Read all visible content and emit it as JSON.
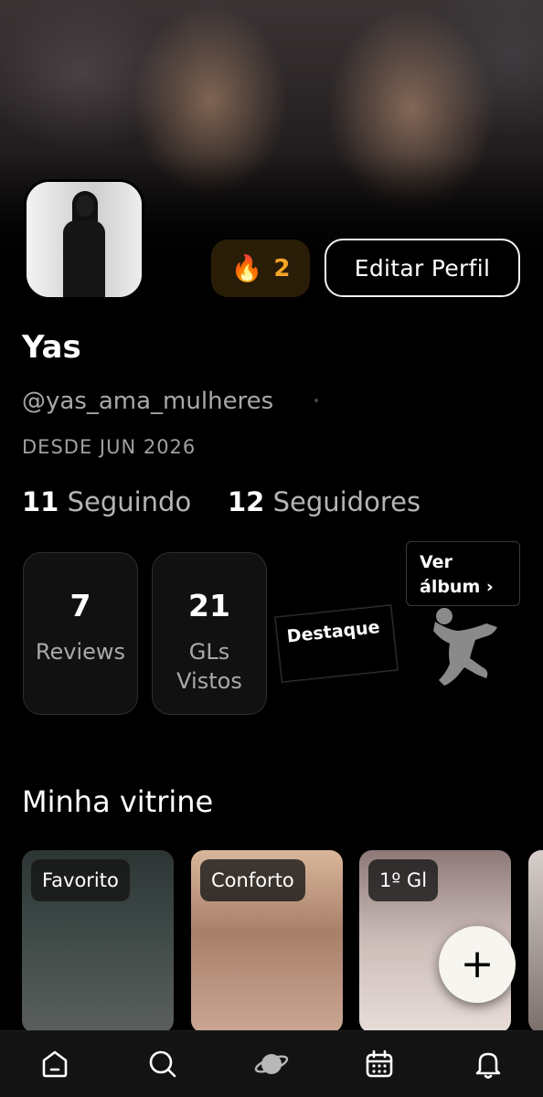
{
  "header": {
    "streak": {
      "icon": "fire-icon",
      "emoji": "🔥",
      "count": "2"
    },
    "edit_button_label": "Editar Perfil"
  },
  "profile": {
    "name": "Yas",
    "handle": "@yas_ama_mulheres",
    "since": "DESDE JUN 2026",
    "following_count": "11",
    "following_label": "Seguindo",
    "followers_count": "12",
    "followers_label": "Seguidores"
  },
  "stats": [
    {
      "value": "7",
      "label": "Reviews"
    },
    {
      "value": "21",
      "label": "GLs Vistos"
    }
  ],
  "badges": {
    "destaque_label": "Destaque",
    "album_label": "Ver álbum ›"
  },
  "showcase": {
    "title": "Minha vitrine",
    "items": [
      {
        "tag": "Favorito"
      },
      {
        "tag": "Conforto"
      },
      {
        "tag": "1º Gl"
      }
    ],
    "add_button_label": "+"
  },
  "tabbar": {
    "items": [
      {
        "icon": "home-icon"
      },
      {
        "icon": "search-icon"
      },
      {
        "icon": "planet-icon"
      },
      {
        "icon": "calendar-icon"
      },
      {
        "icon": "bell-icon"
      }
    ]
  },
  "colors": {
    "background": "#000000",
    "accent_orange": "#f4a525",
    "streak_bg": "#2a1d08",
    "card_bg": "#111111",
    "muted_text": "#a8a8a8"
  }
}
